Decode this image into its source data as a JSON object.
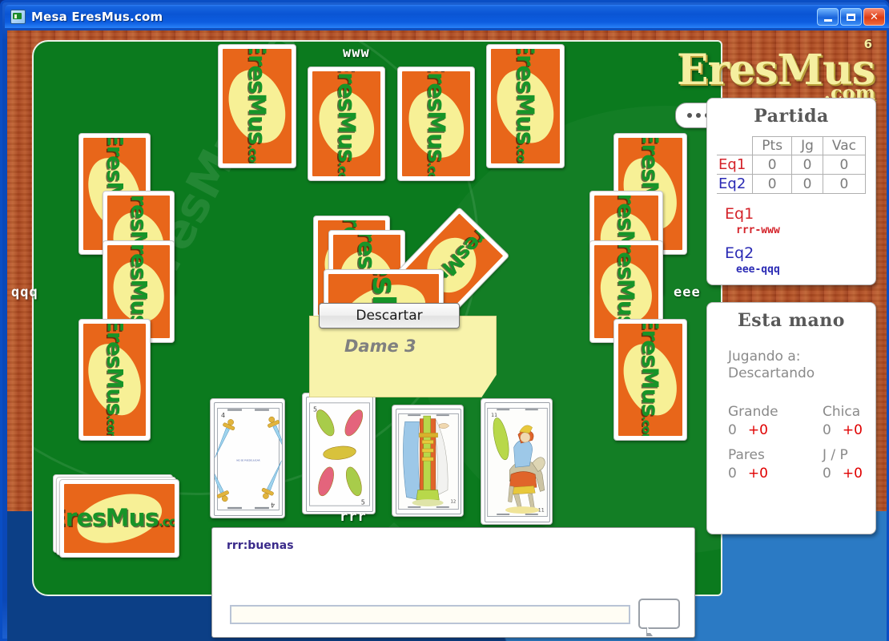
{
  "window": {
    "title": "Mesa EresMus.com",
    "icon": "app-icon",
    "buttons": {
      "minimize": "minimize",
      "maximize": "maximize",
      "close": "close"
    }
  },
  "logo": {
    "main": "EresMus",
    "com": ".com",
    "badge": "6"
  },
  "players": {
    "top": "www",
    "left": "qqq",
    "right": "eee",
    "bottom": "rrr"
  },
  "card_back": {
    "label": "EresMus",
    "dot": ".com"
  },
  "center": {
    "button_label": "Descartar",
    "message": "Dame 3",
    "dots_bubble": "chat-bubble"
  },
  "partida": {
    "title": "Partida",
    "columns": [
      "",
      "Pts",
      "Jg",
      "Vac"
    ],
    "rows": [
      {
        "team": "Eq1",
        "pts": "0",
        "jg": "0",
        "vac": "0"
      },
      {
        "team": "Eq2",
        "pts": "0",
        "jg": "0",
        "vac": "0"
      }
    ],
    "teams": [
      {
        "name": "Eq1",
        "members": "rrr-www"
      },
      {
        "name": "Eq2",
        "members": "eee-qqq"
      }
    ]
  },
  "mano": {
    "title": "Esta mano",
    "playing_label": "Jugando a:",
    "playing_value": "Descartando",
    "stats": [
      {
        "label": "Grande",
        "value": "0",
        "delta": "+0"
      },
      {
        "label": "Chica",
        "value": "0",
        "delta": "+0"
      },
      {
        "label": "Pares",
        "value": "0",
        "delta": "+0"
      },
      {
        "label": "J / P",
        "value": "0",
        "delta": "+0"
      }
    ]
  },
  "chat": {
    "message": "rrr:buenas",
    "input_value": "",
    "input_placeholder": "",
    "send_icon": "speech-bubble-icon"
  },
  "hand_cards": [
    {
      "name": "4-espadas",
      "rank": "4",
      "suit": "espadas"
    },
    {
      "name": "5-bastos",
      "rank": "5",
      "suit": "bastos"
    },
    {
      "name": "rey-bastos",
      "rank": "12",
      "suit": "bastos"
    },
    {
      "name": "caballo-bastos",
      "rank": "11",
      "suit": "bastos"
    }
  ],
  "colors": {
    "felt": "#0b7a1e",
    "card_back": "#e8661a",
    "card_ellipse": "#f7f096",
    "card_text": "#179428",
    "eq1": "#d4232a",
    "eq2": "#2a2ab4",
    "accent_yellow": "#f8f3ab",
    "delta_red": "#e00000",
    "titlebar": "#0a55d4"
  },
  "watermark": "EresMus.com"
}
